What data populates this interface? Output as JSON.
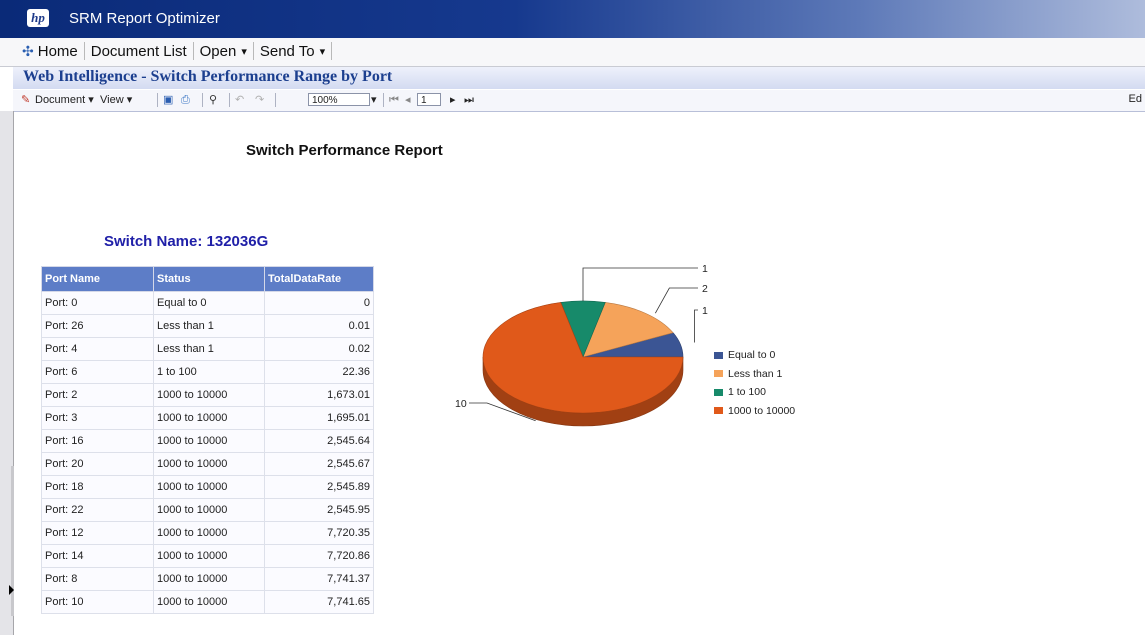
{
  "app": {
    "logo_text": "hp",
    "title": "SRM Report Optimizer"
  },
  "menu": {
    "home": "Home",
    "document_list": "Document List",
    "open": "Open",
    "send_to": "Send To"
  },
  "window": {
    "title": "Web Intelligence - Switch Performance Range by Port"
  },
  "toolbar": {
    "document": "Document",
    "view": "View",
    "zoom": "100%",
    "page": "1",
    "edit_truncated": "Ed"
  },
  "report": {
    "title": "Switch Performance Report",
    "switch_name": "Switch Name: 132036G",
    "columns": [
      "Port Name",
      "Status",
      "TotalDataRate"
    ],
    "rows": [
      [
        "Port: 0",
        "Equal to 0",
        "0"
      ],
      [
        "Port: 26",
        "Less than 1",
        "0.01"
      ],
      [
        "Port: 4",
        "Less than 1",
        "0.02"
      ],
      [
        "Port: 6",
        "1 to 100",
        "22.36"
      ],
      [
        "Port: 2",
        "1000 to 10000",
        "1,673.01"
      ],
      [
        "Port: 3",
        "1000 to 10000",
        "1,695.01"
      ],
      [
        "Port: 16",
        "1000 to 10000",
        "2,545.64"
      ],
      [
        "Port: 20",
        "1000 to 10000",
        "2,545.67"
      ],
      [
        "Port: 18",
        "1000 to 10000",
        "2,545.89"
      ],
      [
        "Port: 22",
        "1000 to 10000",
        "2,545.95"
      ],
      [
        "Port: 12",
        "1000 to 10000",
        "7,720.35"
      ],
      [
        "Port: 14",
        "1000 to 10000",
        "7,720.86"
      ],
      [
        "Port: 8",
        "1000 to 10000",
        "7,741.37"
      ],
      [
        "Port: 10",
        "1000 to 10000",
        "7,741.65"
      ]
    ]
  },
  "chart_data": {
    "type": "pie",
    "categories": [
      "Equal to 0",
      "Less than 1",
      "1 to 100",
      "1000 to 10000"
    ],
    "values": [
      1,
      2,
      1,
      10
    ],
    "colors": [
      "#3b5594",
      "#f5a35a",
      "#178a6a",
      "#e0591a"
    ],
    "legend_position": "right"
  }
}
